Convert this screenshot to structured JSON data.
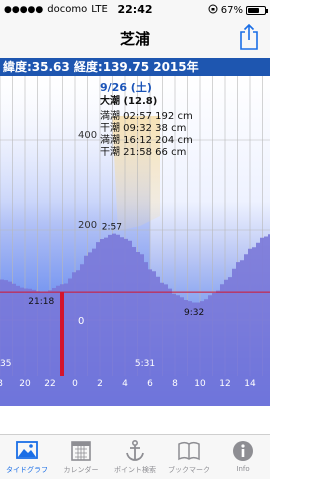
{
  "status_bar": {
    "carrier": "docomo",
    "network": "LTE",
    "time": "22:42",
    "battery": "67%",
    "battery_level": 0.67
  },
  "nav": {
    "title": "芝浦"
  },
  "location": {
    "coordinates": "緯度:35.63 経度:139.75 2015年"
  },
  "info": {
    "date": "9/26 (土)",
    "tide_type": "大潮 (12.8)",
    "tides": [
      "満潮 02:57 192 cm",
      "干潮 09:32 38 cm",
      "満潮 16:12 204 cm",
      "干潮 21:58 66 cm"
    ]
  },
  "chart_data": {
    "type": "area",
    "y_ticks": [
      "400",
      "200",
      "0"
    ],
    "x_ticks": [
      "8",
      "20",
      "22",
      "0",
      "2",
      "4",
      "6",
      "8",
      "10",
      "12",
      "14"
    ],
    "annotations": [
      "2:57",
      "21:18",
      "9:32",
      "5:31",
      "35"
    ],
    "x": [
      -6,
      -4,
      -2.7,
      -1,
      0,
      1,
      2,
      2.95,
      4,
      5,
      6,
      7,
      8,
      9,
      9.53,
      10,
      11,
      12,
      13,
      14,
      15,
      16.2
    ],
    "y": [
      90,
      70,
      62,
      80,
      110,
      150,
      180,
      192,
      180,
      150,
      110,
      80,
      55,
      42,
      38,
      42,
      60,
      90,
      130,
      160,
      185,
      204
    ],
    "current_time_marker": "21:18",
    "current_level_line": true,
    "colors": {
      "area": "#7a78d8",
      "grid": "#b8b8b8",
      "marker": "#d4142c",
      "level_line": "#d4142c"
    }
  },
  "tabs": [
    {
      "label": "タイドグラフ",
      "icon": "tide-graph-icon",
      "active": true
    },
    {
      "label": "カレンダー",
      "icon": "calendar-icon",
      "active": false
    },
    {
      "label": "ポイント検索",
      "icon": "anchor-icon",
      "active": false
    },
    {
      "label": "ブックマーク",
      "icon": "bookmark-icon",
      "active": false
    },
    {
      "label": "Info",
      "icon": "info-icon",
      "active": false
    }
  ]
}
